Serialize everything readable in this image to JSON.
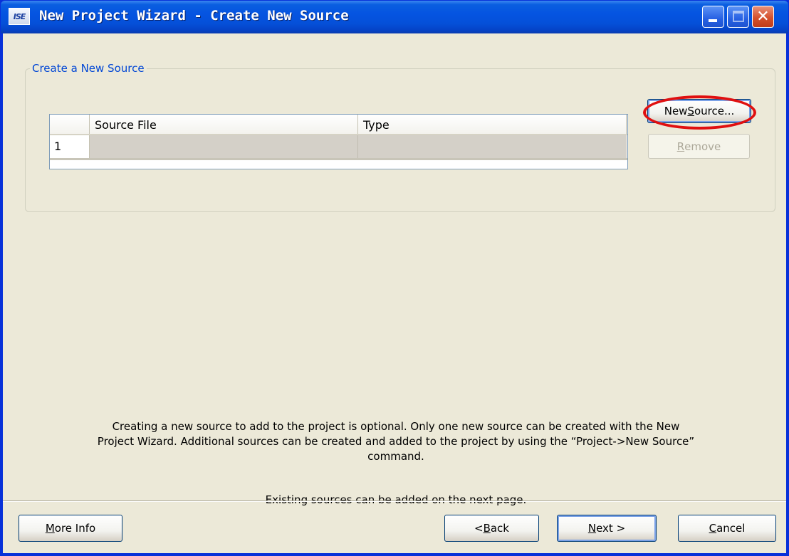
{
  "window": {
    "title": "New Project Wizard - Create New Source",
    "app_icon_text": "ISE",
    "close_glyph": "✕"
  },
  "group": {
    "legend": "Create a New Source"
  },
  "table": {
    "columns": [
      "Source File",
      "Type"
    ],
    "rows": [
      {
        "index": "1",
        "source_file": "",
        "type": ""
      }
    ]
  },
  "buttons": {
    "new_source": {
      "pre": "New ",
      "mnemonic": "S",
      "post": "ource..."
    },
    "remove": {
      "pre": "",
      "mnemonic": "R",
      "post": "emove"
    },
    "more_info": {
      "pre": "",
      "mnemonic": "M",
      "post": "ore Info"
    },
    "back": {
      "pre": "< ",
      "mnemonic": "B",
      "post": "ack"
    },
    "next": {
      "pre": "",
      "mnemonic": "N",
      "post": "ext >"
    },
    "cancel": {
      "pre": "",
      "mnemonic": "C",
      "post": "ancel"
    }
  },
  "description": {
    "line1": "Creating a new source to add to the project is optional. Only one new source can be created with the New",
    "line2": "Project Wizard. Additional sources can be created and added to the project by using the “Project->New Source”",
    "line3": "command.",
    "line4": "Existing sources can be added on the next page."
  },
  "annotation": {
    "color": "#e01010",
    "target": "new-source-button"
  }
}
